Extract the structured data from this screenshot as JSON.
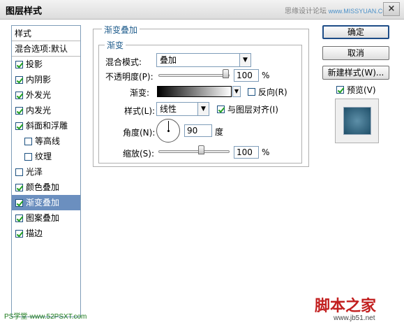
{
  "window": {
    "title": "图层样式",
    "watermark_text": "思缘设计论坛",
    "watermark_url": "www.MISSYUAN.COM",
    "close_symbol": "×"
  },
  "styles_panel": {
    "header": "样式",
    "blend_options": "混合选项:默认",
    "items": [
      {
        "label": "投影",
        "checked": true,
        "sub": false,
        "selected": false
      },
      {
        "label": "内阴影",
        "checked": true,
        "sub": false,
        "selected": false
      },
      {
        "label": "外发光",
        "checked": true,
        "sub": false,
        "selected": false
      },
      {
        "label": "内发光",
        "checked": true,
        "sub": false,
        "selected": false
      },
      {
        "label": "斜面和浮雕",
        "checked": true,
        "sub": false,
        "selected": false
      },
      {
        "label": "等高线",
        "checked": false,
        "sub": true,
        "selected": false
      },
      {
        "label": "纹理",
        "checked": false,
        "sub": true,
        "selected": false
      },
      {
        "label": "光泽",
        "checked": false,
        "sub": false,
        "selected": false
      },
      {
        "label": "颜色叠加",
        "checked": true,
        "sub": false,
        "selected": false
      },
      {
        "label": "渐变叠加",
        "checked": true,
        "sub": false,
        "selected": true
      },
      {
        "label": "图案叠加",
        "checked": true,
        "sub": false,
        "selected": false
      },
      {
        "label": "描边",
        "checked": true,
        "sub": false,
        "selected": false
      }
    ]
  },
  "gradient_overlay": {
    "group_title": "渐变叠加",
    "subgroup_title": "渐变",
    "blend_mode_label": "混合模式:",
    "blend_mode_value": "叠加",
    "opacity_label": "不透明度(P):",
    "opacity_value": "100",
    "opacity_unit": "%",
    "gradient_label": "渐变:",
    "reverse_label": "反向(R)",
    "reverse_checked": false,
    "style_label": "样式(L):",
    "style_value": "线性",
    "align_label": "与图层对齐(I)",
    "align_checked": true,
    "angle_label": "角度(N):",
    "angle_value": "90",
    "angle_unit": "度",
    "scale_label": "缩放(S):",
    "scale_value": "100",
    "scale_unit": "%"
  },
  "buttons": {
    "ok": "确定",
    "cancel": "取消",
    "new_style": "新建样式(W)...",
    "preview_label": "预览(V)",
    "preview_checked": true
  },
  "footer": {
    "left_watermark": "PS学堂·www.52PSXT.com",
    "right_watermark": "脚本之家",
    "right_url": "www.jb51.net"
  }
}
